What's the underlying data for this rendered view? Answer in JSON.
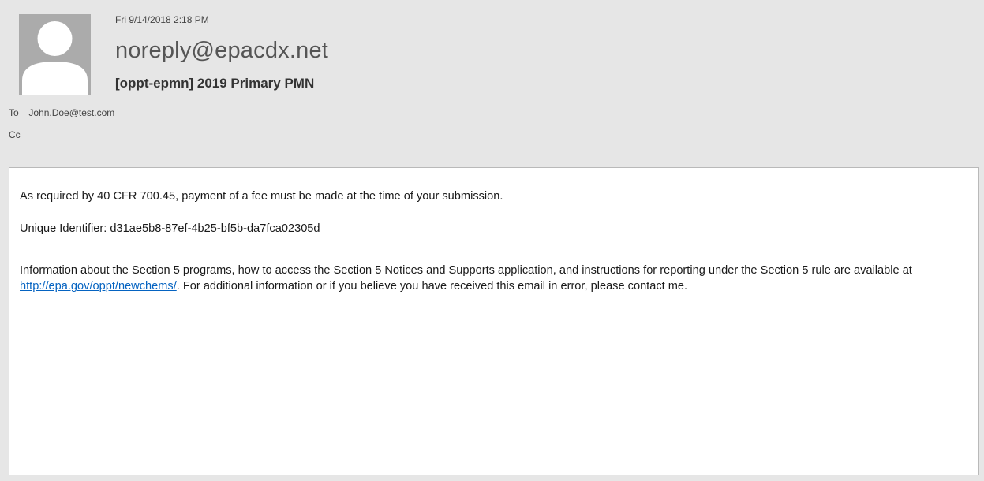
{
  "header": {
    "date": "Fri 9/14/2018 2:18 PM",
    "sender": "noreply@epacdx.net",
    "subject": "[oppt-epmn] 2019 Primary PMN",
    "to_label": "To",
    "to_value": "John.Doe@test.com",
    "cc_label": "Cc",
    "avatar_icon": "person-silhouette-icon"
  },
  "body": {
    "paragraph1": "As required by 40 CFR 700.45, payment of a fee must be made at the time of your submission.",
    "paragraph2": "Unique Identifier: d31ae5b8-87ef-4b25-bf5b-da7fca02305d",
    "paragraph3_before": "Information about the Section 5 programs, how to access the Section 5 Notices and Supports application, and instructions for reporting under the Section 5 rule are available at ",
    "paragraph3_link": "http://epa.gov/oppt/newchems/",
    "paragraph3_after": ". For additional information or if you believe you have received this email in error, please contact me."
  },
  "colors": {
    "header_bg": "#e6e6e6",
    "link": "#0563c1",
    "avatar_bg": "#ababab"
  }
}
